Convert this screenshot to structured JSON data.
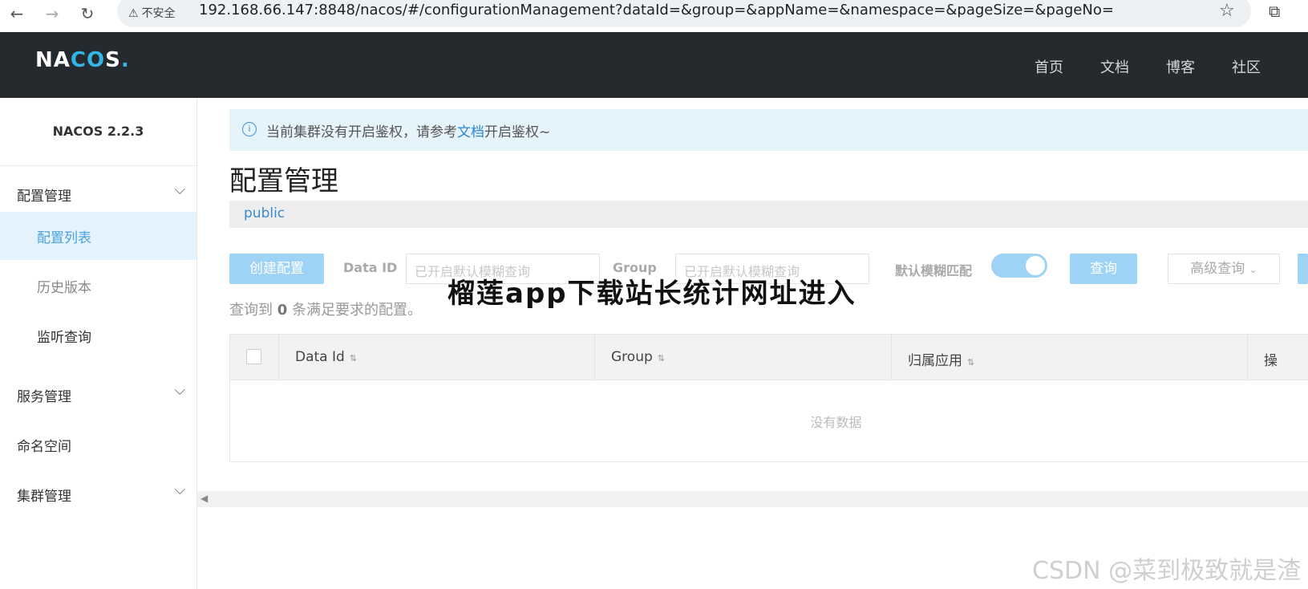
{
  "browser": {
    "security_label": "不安全",
    "url": "192.168.66.147:8848/nacos/#/configurationManagement?dataId=&group=&appName=&namespace=&pageSize=&pageNo="
  },
  "header": {
    "logo": "NACOS.",
    "nav": [
      "首页",
      "文档",
      "博客",
      "社区"
    ]
  },
  "sidebar": {
    "version": "NACOS 2.2.3",
    "menu": [
      {
        "label": "配置管理",
        "expandable": true
      },
      {
        "label": "配置列表",
        "active": true
      },
      {
        "label": "历史版本"
      },
      {
        "label": "监听查询"
      },
      {
        "label": "服务管理",
        "expandable": true
      },
      {
        "label": "命名空间"
      },
      {
        "label": "集群管理",
        "expandable": true
      }
    ]
  },
  "main": {
    "notice_text": "当前集群没有开启鉴权，请参考",
    "notice_link": "文档",
    "notice_suffix": "开启鉴权~",
    "page_title": "配置管理",
    "namespace": "public",
    "create_button": "创建配置",
    "data_id_label": "Data ID",
    "data_id_placeholder": "已开启默认模糊查询",
    "group_label": "Group",
    "group_placeholder": "已开启默认模糊查询",
    "fuzzy_label": "默认模糊匹配",
    "query_button": "查询",
    "advanced_query": "高级查询",
    "result_prefix": "查询到",
    "result_count": "0",
    "result_suffix": "条满足要求的配置。",
    "table": {
      "columns": [
        "Data Id",
        "Group",
        "归属应用",
        "操"
      ],
      "empty_text": "没有数据"
    }
  },
  "overlay_title": "榴莲app下载站长统计网址进入",
  "watermark": "CSDN @菜到极致就是渣"
}
